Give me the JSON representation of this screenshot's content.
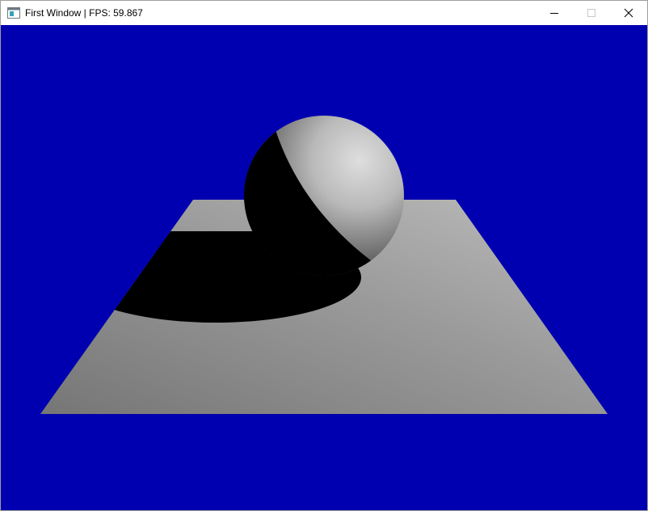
{
  "window": {
    "title": "First Window | FPS: 59.867"
  },
  "icons": {
    "app": "app-window-icon",
    "minimize": "minimize-icon",
    "maximize": "maximize-icon",
    "close": "close-icon"
  },
  "colors": {
    "clear_color": "#0000b0",
    "floor_light": "#b0b0b0",
    "floor_dark": "#7a7a7a",
    "sphere_light": "#d4d4d4",
    "shadow": "#000000"
  }
}
